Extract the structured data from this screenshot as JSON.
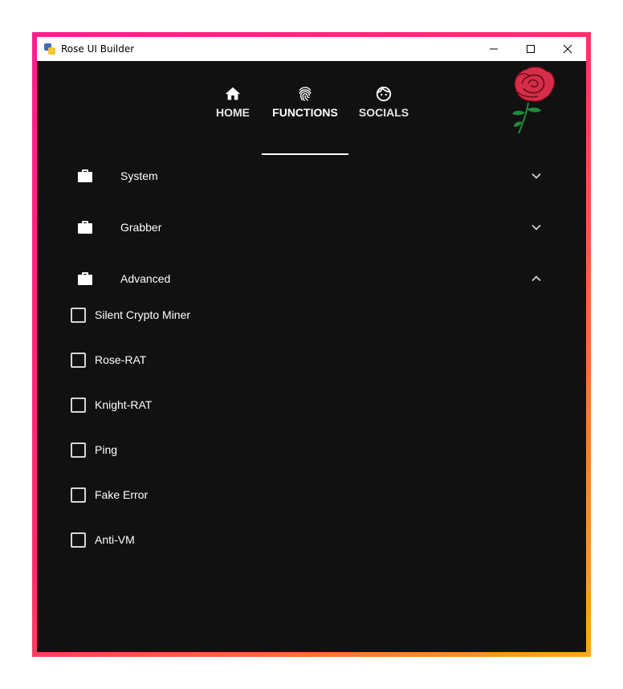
{
  "window": {
    "title": "Rose UI Builder"
  },
  "colors": {
    "frame_start": "#ff1e8c",
    "frame_end": "#ffa81c",
    "background": "#111111",
    "text": "#ffffff"
  },
  "nav": {
    "tabs": [
      {
        "label": "HOME",
        "icon": "home-icon"
      },
      {
        "label": "FUNCTIONS",
        "icon": "fingerprint-icon",
        "active": true
      },
      {
        "label": "SOCIALS",
        "icon": "face-icon"
      }
    ]
  },
  "logo": "rose-logo",
  "sections": [
    {
      "label": "System",
      "icon": "briefcase-icon",
      "expanded": false
    },
    {
      "label": "Grabber",
      "icon": "briefcase-icon",
      "expanded": false
    },
    {
      "label": "Advanced",
      "icon": "briefcase-icon",
      "expanded": true
    }
  ],
  "advanced_options": [
    {
      "label": "Silent Crypto Miner",
      "checked": false
    },
    {
      "label": "Rose-RAT",
      "checked": false
    },
    {
      "label": "Knight-RAT",
      "checked": false
    },
    {
      "label": "Ping",
      "checked": false
    },
    {
      "label": "Fake Error",
      "checked": false
    },
    {
      "label": "Anti-VM",
      "checked": false
    }
  ]
}
